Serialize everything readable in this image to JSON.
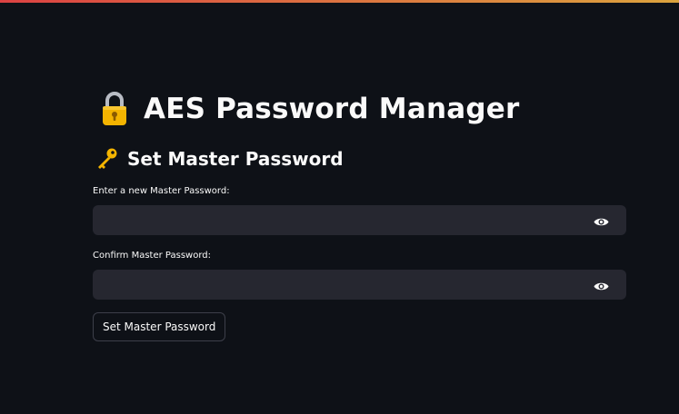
{
  "app": {
    "title": "AES Password Manager",
    "title_icon": "lock-icon"
  },
  "section": {
    "title": "Set Master Password",
    "icon": "key-icon"
  },
  "fields": {
    "new_password": {
      "label": "Enter a new Master Password:",
      "value": "",
      "type": "password",
      "toggle_icon": "eye-icon"
    },
    "confirm_password": {
      "label": "Confirm Master Password:",
      "value": "",
      "type": "password",
      "toggle_icon": "eye-icon"
    }
  },
  "actions": {
    "submit_label": "Set Master Password"
  },
  "colors": {
    "background": "#0e1117",
    "input_background": "#262730",
    "text": "#fafafa",
    "accent_gradient_start": "#ff4b4b",
    "accent_gradient_end": "#ffbd45"
  }
}
